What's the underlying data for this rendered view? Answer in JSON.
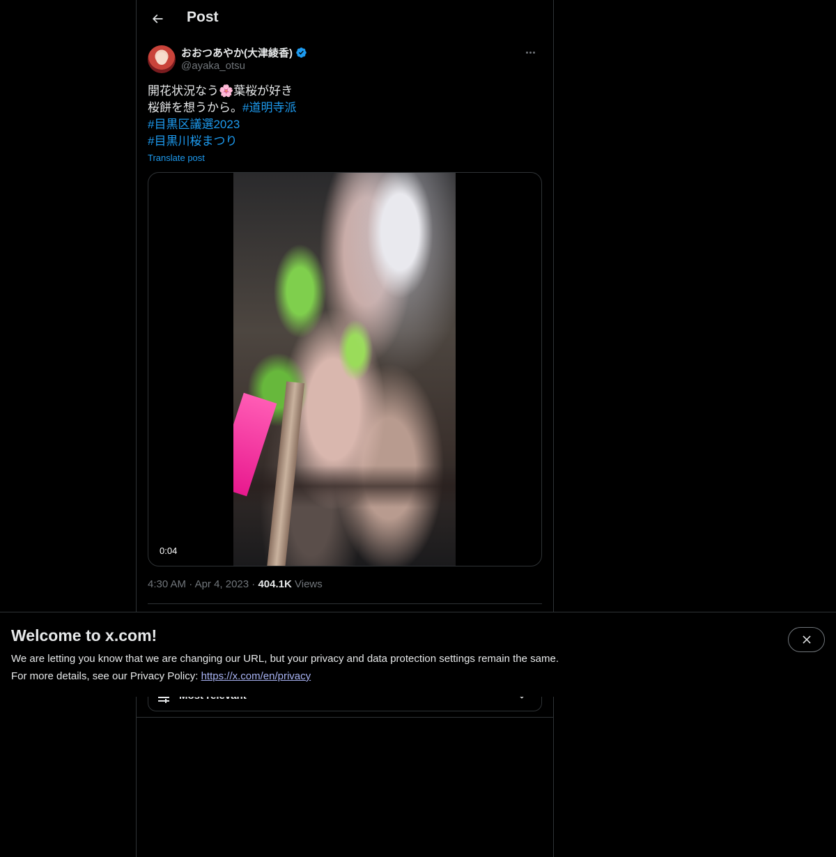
{
  "header": {
    "title": "Post"
  },
  "post": {
    "author": {
      "display_name": "おおつあやか(大津綾香)",
      "handle": "@ayaka_otsu",
      "verified": true
    },
    "text": {
      "line1": "開花状況なう🌸葉桜が好き",
      "line2_text": "桜餅を想うから。",
      "line2_hashtag": "#道明寺派",
      "hashtag2": "#目黒区議選2023",
      "hashtag3": "#目黒川桜まつり"
    },
    "translate_label": "Translate post",
    "video": {
      "duration": "0:04"
    },
    "meta": {
      "time": "4:30 AM",
      "separator": "·",
      "date": "Apr 4, 2023",
      "views_count": "404.1K",
      "views_label": "Views"
    }
  },
  "replies": {
    "sort_label": "Most relevant"
  },
  "banner": {
    "title": "Welcome to x.com!",
    "line1": "We are letting you know that we are changing our URL, but your privacy and data protection settings remain the same.",
    "line2_prefix": "For more details, see our Privacy Policy: ",
    "link": "https://x.com/en/privacy"
  },
  "colors": {
    "background": "#000000",
    "text": "#e7e9ea",
    "secondary_text": "#71767b",
    "accent": "#1d9bf0",
    "border": "#2f3336"
  }
}
